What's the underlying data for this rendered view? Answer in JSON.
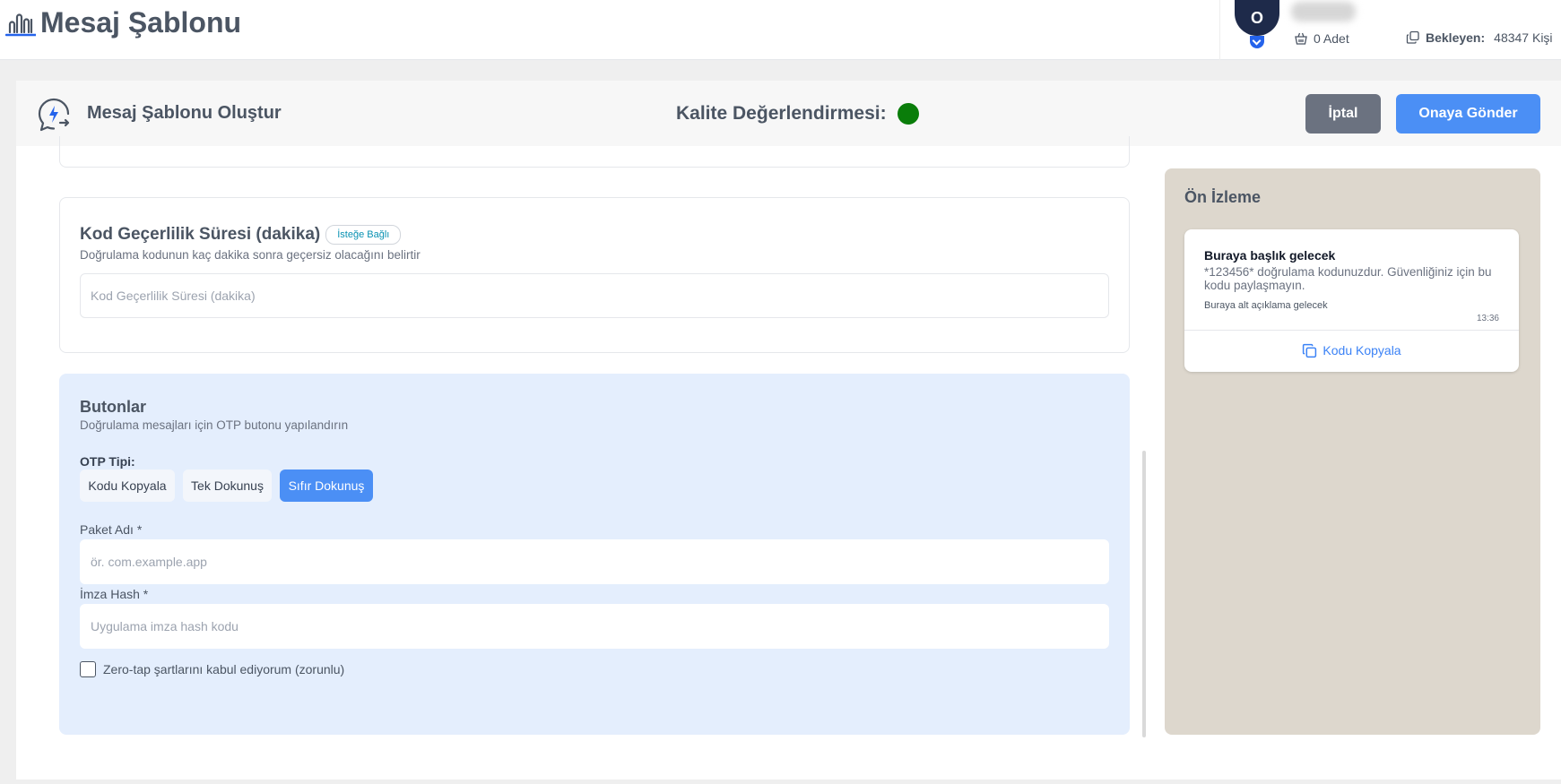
{
  "topbar": {
    "title": "Mesaj Şablonu",
    "avatar_initial": "O",
    "credits": "0 Adet",
    "pending_label": "Bekleyen:",
    "pending_value": "48347 Kişi"
  },
  "header": {
    "title": "Mesaj Şablonu Oluştur",
    "quality_label": "Kalite Değerlendirmesi:",
    "quality_color": "#0a7d0a",
    "cancel_label": "İptal",
    "submit_label": "Onaya Gönder"
  },
  "code_section": {
    "title": "Kod Geçerlilik Süresi (dakika)",
    "badge": "İsteğe Bağlı",
    "description": "Doğrulama kodunun kaç dakika sonra geçersiz olacağını belirtir",
    "input_placeholder": "Kod Geçerlilik Süresi (dakika)",
    "input_value": ""
  },
  "buttons_section": {
    "title": "Butonlar",
    "description": "Doğrulama mesajları için OTP butonu yapılandırın",
    "otp_label": "OTP Tipi:",
    "otp_types": [
      "Kodu Kopyala",
      "Tek Dokunuş",
      "Sıfır Dokunuş"
    ],
    "otp_selected": "Sıfır Dokunuş",
    "package_label": "Paket Adı *",
    "package_placeholder": "ör. com.example.app",
    "hash_label": "İmza Hash *",
    "hash_placeholder": "Uygulama imza hash kodu",
    "terms_label": "Zero-tap şartlarını kabul ediyorum (zorunlu)",
    "terms_checked": false
  },
  "preview": {
    "title": "Ön İzleme",
    "message_title": "Buraya başlık gelecek",
    "message_body": "*123456* doğrulama kodunuzdur. Güvenliğiniz için bu kodu paylaşmayın.",
    "message_footer": "Buraya alt açıklama gelecek",
    "time": "13:36",
    "button_label": "Kodu Kopyala"
  },
  "colors": {
    "accent": "#4b8ff5",
    "secondary_button": "#6b7280",
    "buttons_section_bg": "#e4eefd",
    "preview_bg": "#ddd7cd"
  }
}
